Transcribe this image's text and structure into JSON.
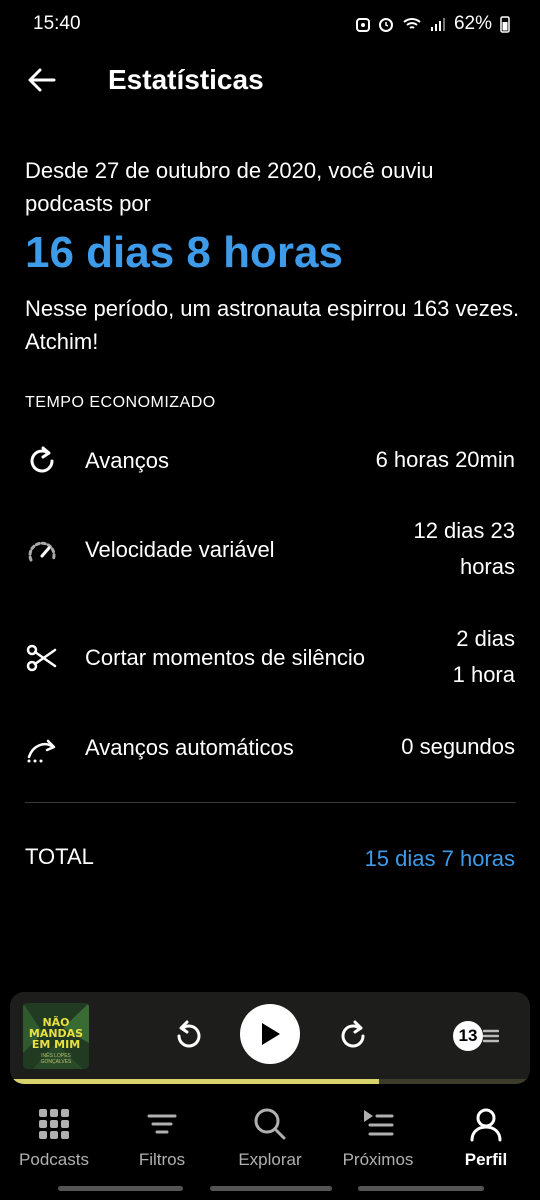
{
  "status_bar": {
    "time": "15:40",
    "battery": "62%"
  },
  "header": {
    "title": "Estatísticas"
  },
  "summary": {
    "intro": "Desde 27 de outubro de 2020, você ouviu podcasts por",
    "total_listened": "16 dias 8 horas",
    "fun_fact": "Nesse período, um astronauta espirrou 163 vezes. Atchim!"
  },
  "time_saved": {
    "section_title": "TEMPO ECONOMIZADO",
    "rows": [
      {
        "icon": "skip-icon",
        "label": "Avanços",
        "value_lines": [
          "6 horas 20min"
        ]
      },
      {
        "icon": "speedometer-icon",
        "label": "Velocidade variável",
        "value_lines": [
          "12 dias 23",
          "horas"
        ]
      },
      {
        "icon": "scissors-icon",
        "label": "Cortar momentos de silêncio",
        "value_lines": [
          "2 dias",
          "1 hora"
        ]
      },
      {
        "icon": "auto-skip-icon",
        "label": "Avanços automáticos",
        "value_lines": [
          "0 segundos"
        ]
      }
    ],
    "total_label": "TOTAL",
    "total_value": "15 dias 7 horas"
  },
  "mini_player": {
    "artwork_title": "NÃO MANDAS EM MIM",
    "artwork_subtitle": "INÊS LOPES GONÇALVES",
    "up_next_count": "13",
    "progress": 0.71,
    "colors": {
      "progress": "#d9d36b",
      "background": "#1d1d1b"
    }
  },
  "bottom_nav": {
    "items": [
      {
        "label": "Podcasts",
        "icon": "grid-icon"
      },
      {
        "label": "Filtros",
        "icon": "filter-icon"
      },
      {
        "label": "Explorar",
        "icon": "search-icon"
      },
      {
        "label": "Próximos",
        "icon": "up-next-icon"
      },
      {
        "label": "Perfil",
        "icon": "profile-icon",
        "active": true
      }
    ]
  },
  "colors": {
    "accent": "#3d9be9",
    "background": "#000000"
  }
}
